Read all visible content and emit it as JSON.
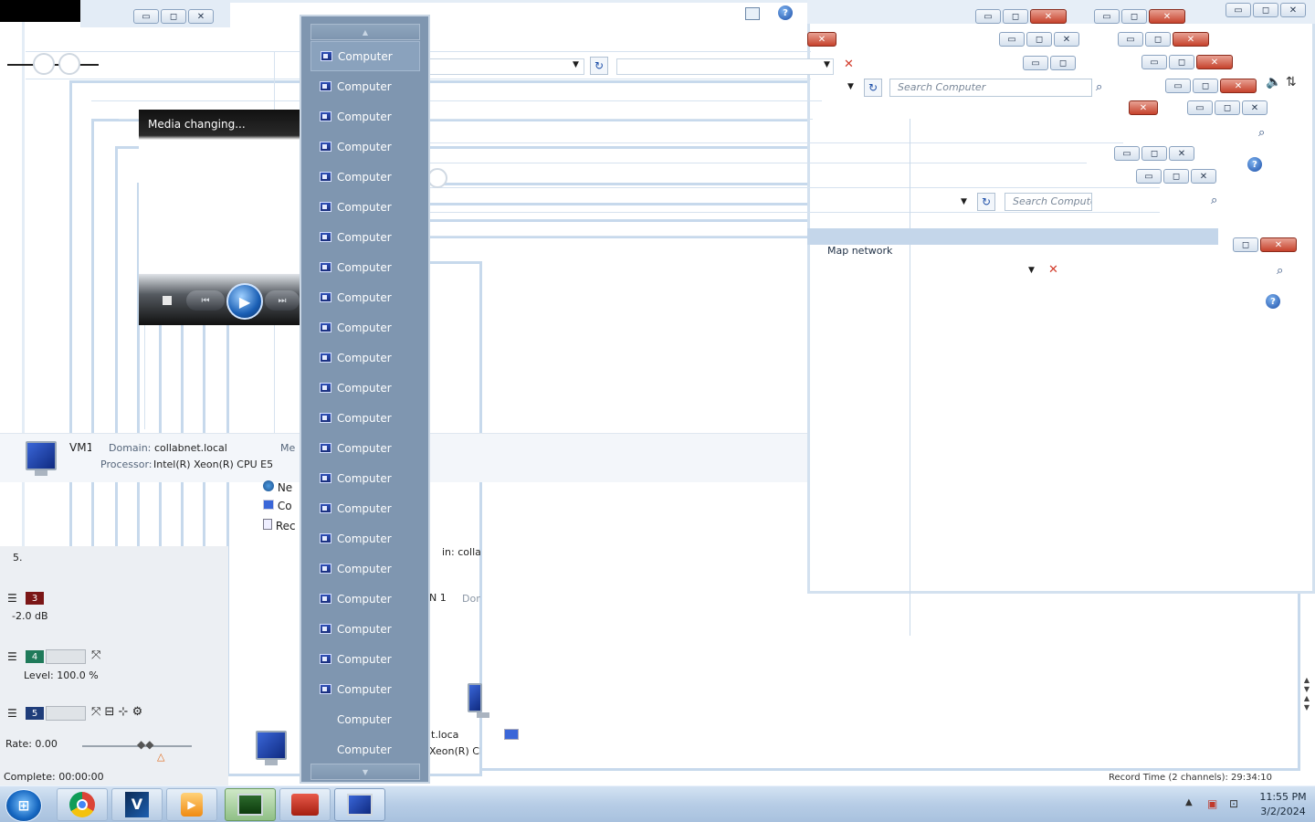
{
  "player": {
    "status": "Media changing...",
    "stop_glyph": "■",
    "prev_glyph": "⏮",
    "play_glyph": "▶",
    "next_glyph": "⏭"
  },
  "dropdown": {
    "up_glyph": "▲",
    "down_glyph": "▼",
    "items": [
      {
        "label": "Computer",
        "icon": "computer-icon"
      },
      {
        "label": "Computer",
        "icon": "computer-icon"
      },
      {
        "label": "Computer",
        "icon": "computer-icon"
      },
      {
        "label": "Computer",
        "icon": "computer-icon"
      },
      {
        "label": "Computer",
        "icon": "computer-icon"
      },
      {
        "label": "Computer",
        "icon": "computer-icon"
      },
      {
        "label": "Computer",
        "icon": "computer-icon"
      },
      {
        "label": "Computer",
        "icon": "computer-icon"
      },
      {
        "label": "Computer",
        "icon": "computer-icon"
      },
      {
        "label": "Computer",
        "icon": "computer-icon"
      },
      {
        "label": "Computer",
        "icon": "computer-icon"
      },
      {
        "label": "Computer",
        "icon": "computer-icon"
      },
      {
        "label": "Computer",
        "icon": "computer-icon"
      },
      {
        "label": "Computer",
        "icon": "computer-icon"
      },
      {
        "label": "Computer",
        "icon": "computer-icon"
      },
      {
        "label": "Computer",
        "icon": "computer-icon"
      },
      {
        "label": "Computer",
        "icon": "computer-icon"
      },
      {
        "label": "Computer",
        "icon": "computer-icon"
      },
      {
        "label": "Computer",
        "icon": "computer-icon"
      },
      {
        "label": "Computer",
        "icon": "computer-icon"
      },
      {
        "label": "Computer",
        "icon": "computer-icon"
      },
      {
        "label": "Computer",
        "icon": "computer-icon"
      },
      {
        "label": "Computer",
        "icon": "none"
      },
      {
        "label": "Computer",
        "icon": "none"
      }
    ]
  },
  "details": {
    "name_fragment": "VM1",
    "domain_label": "Domain:",
    "domain_value": "collabnet.local",
    "processor_label": "Processor:",
    "processor_value": "Intel(R) Xeon(R) CPU E5...",
    "mem_fragment": "Me"
  },
  "nav_fragments": {
    "network": "Ne",
    "computer": "Co",
    "recycle": "Rec"
  },
  "ghost_fragments": {
    "domain_a": "in:  colla",
    "domain_b": "t.loca",
    "processor_b": "Xeon(R) CP",
    "om": "Dom",
    "n1": "N 1"
  },
  "search": {
    "placeholder_1": "Search Computer",
    "placeholder_2": "Search Compute",
    "map_drive": "Map network drive"
  },
  "mixer": {
    "track3": "3",
    "track4": "4",
    "track5": "5",
    "gain": "-2.0 dB",
    "level": "Level: 100.0 %",
    "rate": "Rate: 0.00",
    "complete": "Complete: 00:00:00",
    "record_time": "Record Time (2 channels): 29:34:10",
    "five_label": "5."
  },
  "taskbar": {
    "start_glyph": "⊞",
    "time": "11:55 PM",
    "date": "3/2/2024",
    "apps": [
      "Google Chrome",
      "Vegas Pro",
      "Media Player",
      "Computer Management",
      "Toolbox",
      "Computer"
    ]
  },
  "captions": {
    "minimize": "▭",
    "maximize": "◻",
    "close": "✕",
    "help": "?"
  },
  "colors": {
    "dropdown_bg": "#7f96b0",
    "taskbar": "#b7cde6",
    "close_red": "#c6422c"
  }
}
